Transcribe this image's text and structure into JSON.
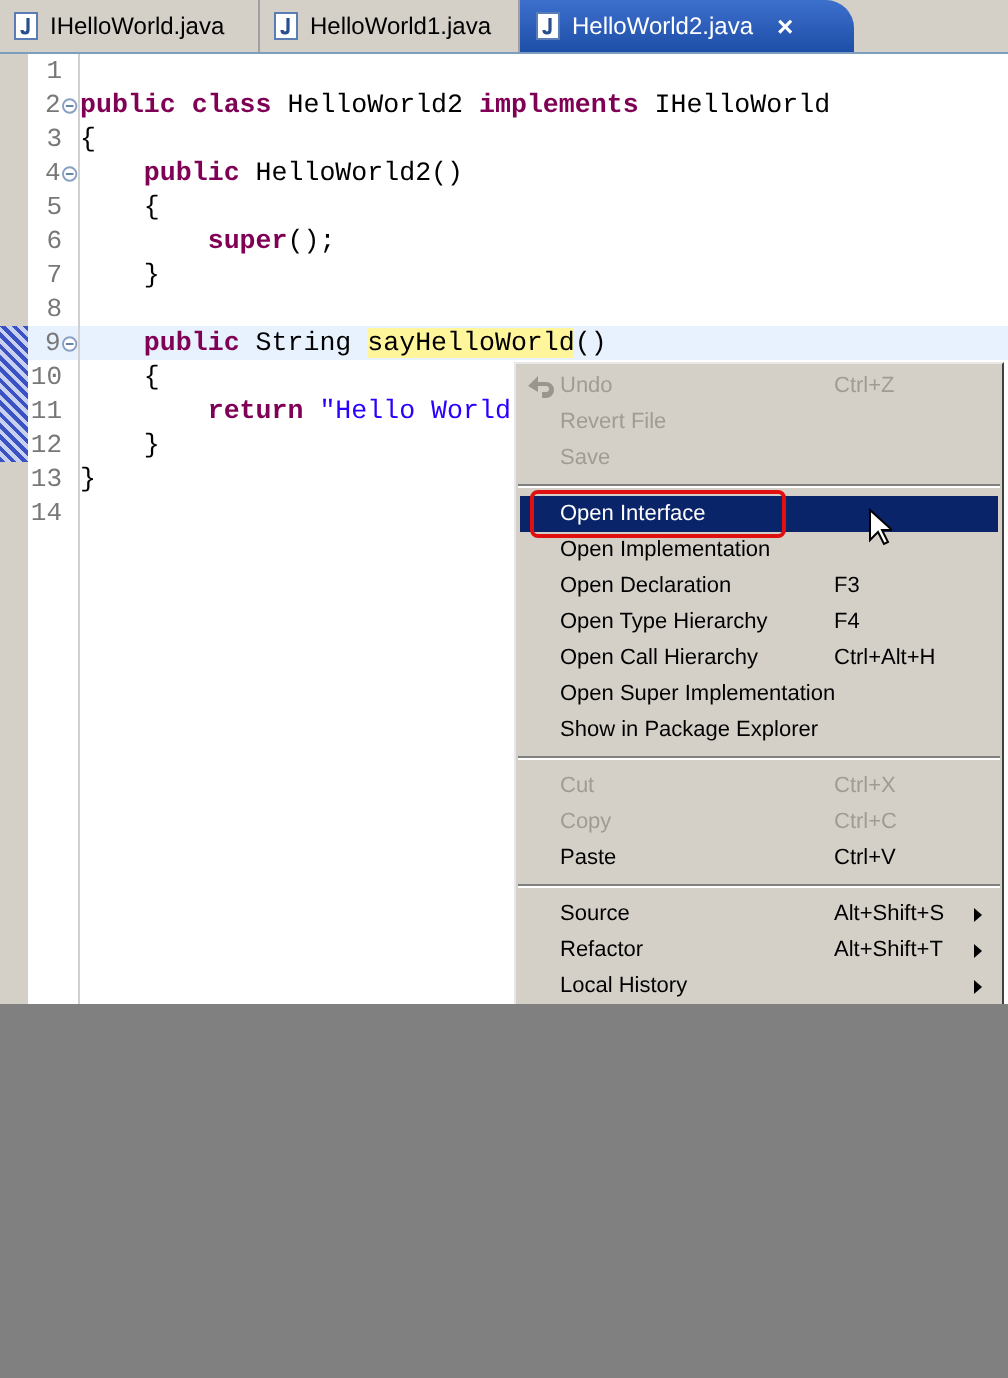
{
  "tabs": [
    {
      "label": "IHelloWorld.java",
      "selected": false
    },
    {
      "label": "HelloWorld1.java",
      "selected": false
    },
    {
      "label": "HelloWorld2.java",
      "selected": true,
      "close": "×"
    }
  ],
  "editor": {
    "lines": [
      {
        "number": "1",
        "fold": false,
        "current": false,
        "occurrence": false
      },
      {
        "number": "2",
        "fold": true,
        "current": false,
        "occurrence": false,
        "tokens": [
          {
            "kind": "keyword",
            "text": "public class"
          },
          {
            "kind": "plain",
            "text": " HelloWorld2 "
          },
          {
            "kind": "keyword",
            "text": "implements"
          },
          {
            "kind": "plain",
            "text": " IHelloWorld"
          }
        ]
      },
      {
        "number": "3",
        "fold": false,
        "current": false,
        "occurrence": false,
        "tokens": [
          {
            "kind": "plain",
            "text": "{"
          }
        ]
      },
      {
        "number": "4",
        "fold": true,
        "current": false,
        "occurrence": false,
        "tokens": [
          {
            "kind": "keyword",
            "text": "    public"
          },
          {
            "kind": "plain",
            "text": " HelloWorld2()"
          }
        ]
      },
      {
        "number": "5",
        "fold": false,
        "current": false,
        "occurrence": false,
        "tokens": [
          {
            "kind": "plain",
            "text": "    {"
          }
        ]
      },
      {
        "number": "6",
        "fold": false,
        "current": false,
        "occurrence": false,
        "tokens": [
          {
            "kind": "keyword",
            "text": "        super"
          },
          {
            "kind": "plain",
            "text": "();"
          }
        ]
      },
      {
        "number": "7",
        "fold": false,
        "current": false,
        "occurrence": false,
        "tokens": [
          {
            "kind": "plain",
            "text": "    }"
          }
        ]
      },
      {
        "number": "8",
        "fold": false,
        "current": false,
        "occurrence": false
      },
      {
        "number": "9",
        "fold": true,
        "current": true,
        "occurrence": true,
        "tokens": [
          {
            "kind": "keyword",
            "text": "    public"
          },
          {
            "kind": "plain",
            "text": " String "
          },
          {
            "kind": "match",
            "text": "sayHelloWorld"
          },
          {
            "kind": "plain",
            "text": "()"
          }
        ]
      },
      {
        "number": "10",
        "fold": false,
        "current": false,
        "occurrence": true,
        "tokens": [
          {
            "kind": "plain",
            "text": "    {"
          }
        ]
      },
      {
        "number": "11",
        "fold": false,
        "current": false,
        "occurrence": true,
        "tokens": [
          {
            "kind": "keyword",
            "text": "        return"
          },
          {
            "kind": "string",
            "text": " \"Hello World"
          }
        ]
      },
      {
        "number": "12",
        "fold": false,
        "current": false,
        "occurrence": true,
        "tokens": [
          {
            "kind": "plain",
            "text": "    }"
          }
        ]
      },
      {
        "number": "13",
        "fold": false,
        "current": false,
        "occurrence": false,
        "tokens": [
          {
            "kind": "plain",
            "text": "}"
          }
        ]
      },
      {
        "number": "14",
        "fold": false,
        "current": false,
        "occurrence": false
      }
    ]
  },
  "context_menu": {
    "items": [
      {
        "kind": "item",
        "label": "Undo",
        "shortcut": "Ctrl+Z",
        "disabled": true,
        "selected": false,
        "icon": true
      },
      {
        "kind": "item",
        "label": "Revert File",
        "disabled": true,
        "selected": false
      },
      {
        "kind": "item",
        "label": "Save",
        "disabled": true,
        "selected": false
      },
      {
        "kind": "separator"
      },
      {
        "kind": "item",
        "label": "Open Interface",
        "disabled": false,
        "selected": true,
        "circled": true
      },
      {
        "kind": "item",
        "label": "Open Implementation",
        "disabled": false,
        "selected": false
      },
      {
        "kind": "item",
        "label": "Open Declaration",
        "shortcut": "F3",
        "disabled": false,
        "selected": false
      },
      {
        "kind": "item",
        "label": "Open Type Hierarchy",
        "shortcut": "F4",
        "disabled": false,
        "selected": false
      },
      {
        "kind": "item",
        "label": "Open Call Hierarchy",
        "shortcut": "Ctrl+Alt+H",
        "disabled": false,
        "selected": false
      },
      {
        "kind": "item",
        "label": "Open Super Implementation",
        "disabled": false,
        "selected": false
      },
      {
        "kind": "item",
        "label": "Show in Package Explorer",
        "disabled": false,
        "selected": false
      },
      {
        "kind": "separator"
      },
      {
        "kind": "item",
        "label": "Cut",
        "shortcut": "Ctrl+X",
        "disabled": true,
        "selected": false
      },
      {
        "kind": "item",
        "label": "Copy",
        "shortcut": "Ctrl+C",
        "disabled": true,
        "selected": false
      },
      {
        "kind": "item",
        "label": "Paste",
        "shortcut": "Ctrl+V",
        "disabled": false,
        "selected": false
      },
      {
        "kind": "separator"
      },
      {
        "kind": "item",
        "label": "Source",
        "shortcut": "Alt+Shift+S",
        "disabled": false,
        "selected": false,
        "submenu": true
      },
      {
        "kind": "item",
        "label": "Refactor",
        "shortcut": "Alt+Shift+T",
        "disabled": false,
        "selected": false,
        "submenu": true
      },
      {
        "kind": "item",
        "label": "Local History",
        "disabled": false,
        "selected": false,
        "submenu": true
      }
    ]
  }
}
